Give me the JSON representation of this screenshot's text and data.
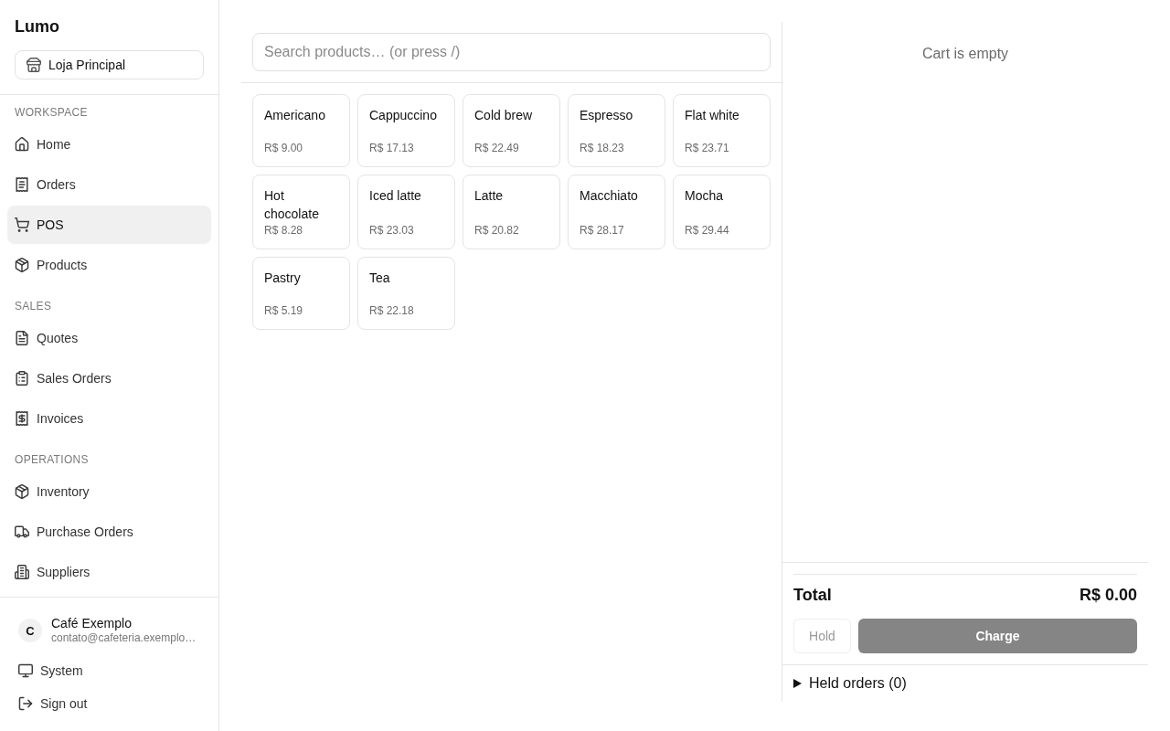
{
  "sidebar": {
    "brand": "Lumo",
    "store_selector": {
      "label": "Loja Principal"
    },
    "sections": [
      {
        "heading": "WORKSPACE",
        "items": [
          {
            "label": "Home",
            "selected": false
          },
          {
            "label": "Orders",
            "selected": false
          },
          {
            "label": "POS",
            "selected": true
          },
          {
            "label": "Products",
            "selected": false
          }
        ]
      },
      {
        "heading": "SALES",
        "items": [
          {
            "label": "Quotes",
            "selected": false
          },
          {
            "label": "Sales Orders",
            "selected": false
          },
          {
            "label": "Invoices",
            "selected": false
          }
        ]
      },
      {
        "heading": "OPERATIONS",
        "items": [
          {
            "label": "Inventory",
            "selected": false
          },
          {
            "label": "Purchase Orders",
            "selected": false
          },
          {
            "label": "Suppliers",
            "selected": false
          }
        ]
      }
    ],
    "user": {
      "initial": "C",
      "name": "Café Exemplo",
      "email": "contato@cafeteria.exemplo…"
    },
    "footer_items": [
      {
        "label": "System"
      },
      {
        "label": "Sign out"
      }
    ]
  },
  "pos": {
    "search": {
      "placeholder": "Search products… (or press /)"
    },
    "products": [
      {
        "name": "Americano",
        "price": "R$ 9.00"
      },
      {
        "name": "Cappuccino",
        "price": "R$ 17.13"
      },
      {
        "name": "Cold brew",
        "price": "R$ 22.49"
      },
      {
        "name": "Espresso",
        "price": "R$ 18.23"
      },
      {
        "name": "Flat white",
        "price": "R$ 23.71"
      },
      {
        "name": "Hot chocolate",
        "price": "R$ 8.28"
      },
      {
        "name": "Iced latte",
        "price": "R$ 23.03"
      },
      {
        "name": "Latte",
        "price": "R$ 20.82"
      },
      {
        "name": "Macchiato",
        "price": "R$ 28.17"
      },
      {
        "name": "Mocha",
        "price": "R$ 29.44"
      },
      {
        "name": "Pastry",
        "price": "R$ 5.19"
      },
      {
        "name": "Tea",
        "price": "R$ 22.18"
      }
    ]
  },
  "cart": {
    "empty_message": "Cart is empty",
    "total_label": "Total",
    "total_value": "R$ 0.00",
    "buttons": [
      {
        "label": "Hold",
        "kind": "secondary",
        "disabled": true
      },
      {
        "label": "Charge",
        "kind": "primary",
        "disabled": true
      }
    ],
    "held_orders": {
      "label": "Held orders (0)",
      "expanded": false
    }
  }
}
